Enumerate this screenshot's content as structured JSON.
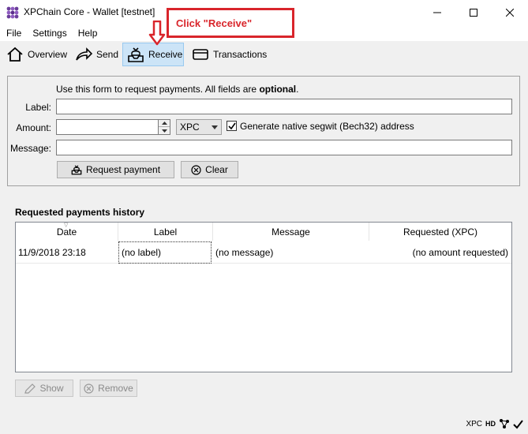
{
  "window": {
    "title": "XPChain Core - Wallet [testnet]"
  },
  "annotation": {
    "text": "Click \"Receive\"",
    "color": "#d9252b"
  },
  "menu": [
    "File",
    "Settings",
    "Help"
  ],
  "toolbar": {
    "overview": "Overview",
    "send": "Send",
    "receive": "Receive",
    "transactions": "Transactions",
    "active": "receive"
  },
  "form": {
    "info_prefix": "Use this form to request payments. All fields are ",
    "info_bold": "optional",
    "info_suffix": ".",
    "label_label": "Label:",
    "amount_label": "Amount:",
    "message_label": "Message:",
    "label_value": "",
    "amount_value": "",
    "message_value": "",
    "unit": "XPC",
    "segwit_label": "Generate native segwit (Bech32) address",
    "segwit_checked": true,
    "request_button": "Request payment",
    "clear_button": "Clear"
  },
  "history": {
    "title": "Requested payments history",
    "columns": [
      "Date",
      "Label",
      "Message",
      "Requested (XPC)"
    ],
    "rows": [
      {
        "date": "11/9/2018 23:18",
        "label": "(no label)",
        "message": "(no message)",
        "amount": "(no amount requested)"
      }
    ],
    "show_button": "Show",
    "remove_button": "Remove"
  },
  "status": {
    "unit": "XPC",
    "hd": "HD"
  }
}
